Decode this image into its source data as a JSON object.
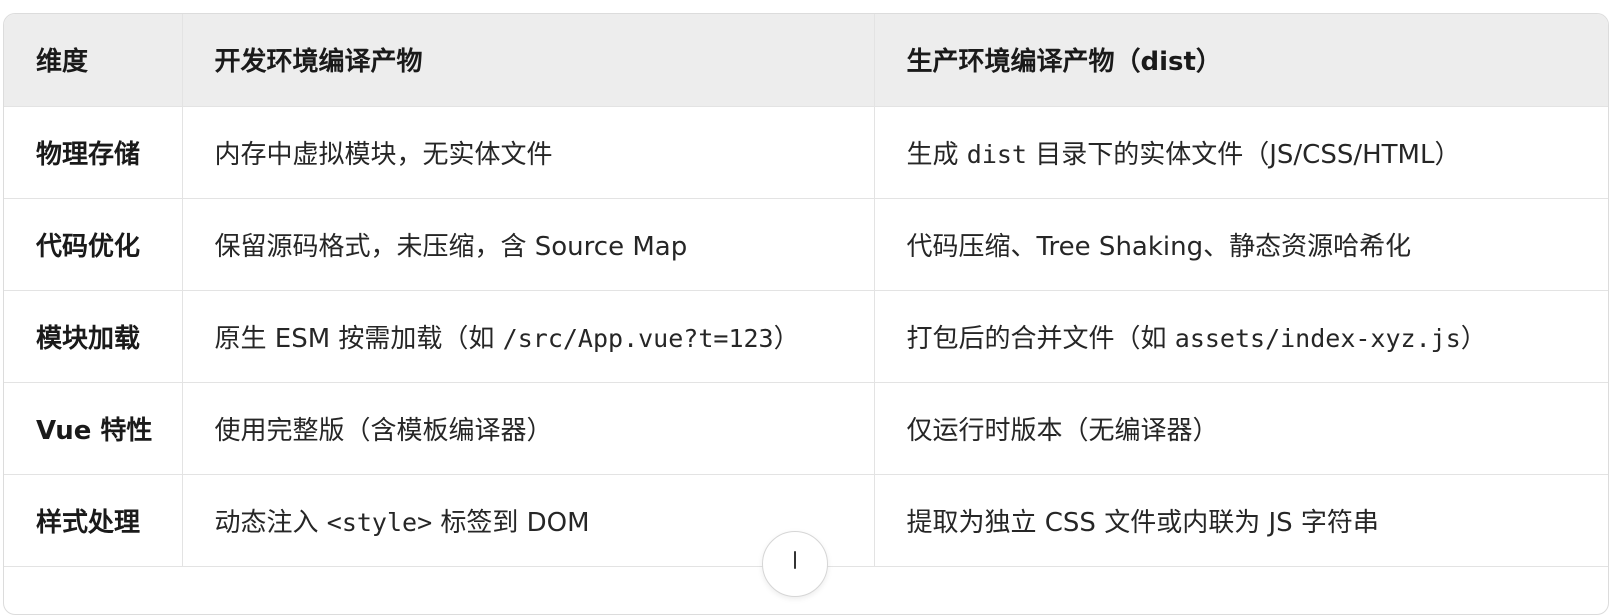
{
  "table": {
    "headers": [
      "维度",
      "开发环境编译产物",
      "生产环境编译产物（dist）"
    ],
    "rows": [
      {
        "key": "物理存储",
        "dev": [
          {
            "t": "内存中虚拟模块，无实体文件"
          }
        ],
        "prod": [
          {
            "t": "生成 "
          },
          {
            "t": "dist",
            "code": true
          },
          {
            "t": " 目录下的实体文件（JS/CSS/HTML）"
          }
        ]
      },
      {
        "key": "代码优化",
        "dev": [
          {
            "t": "保留源码格式，未压缩，含 Source Map"
          }
        ],
        "prod": [
          {
            "t": "代码压缩、Tree Shaking、静态资源哈希化"
          }
        ]
      },
      {
        "key": "模块加载",
        "dev": [
          {
            "t": "原生 ESM 按需加载（如 "
          },
          {
            "t": "/src/App.vue?t=123",
            "code": true
          },
          {
            "t": "）"
          }
        ],
        "prod": [
          {
            "t": "打包后的合并文件（如 "
          },
          {
            "t": "assets/index-xyz.js",
            "code": true
          },
          {
            "t": "）"
          }
        ]
      },
      {
        "key": "Vue 特性",
        "dev": [
          {
            "t": "使用完整版（含模板编译器）"
          }
        ],
        "prod": [
          {
            "t": "仅运行时版本（无编译器）"
          }
        ]
      },
      {
        "key": "样式处理",
        "dev": [
          {
            "t": "动态注入 "
          },
          {
            "t": "<style>",
            "code": true
          },
          {
            "t": " 标签到 DOM"
          }
        ],
        "prod": [
          {
            "t": "提取为独立 CSS 文件或内联为 JS 字符串"
          }
        ]
      }
    ]
  },
  "scroll_button": {
    "icon": "arrow-down-icon"
  }
}
